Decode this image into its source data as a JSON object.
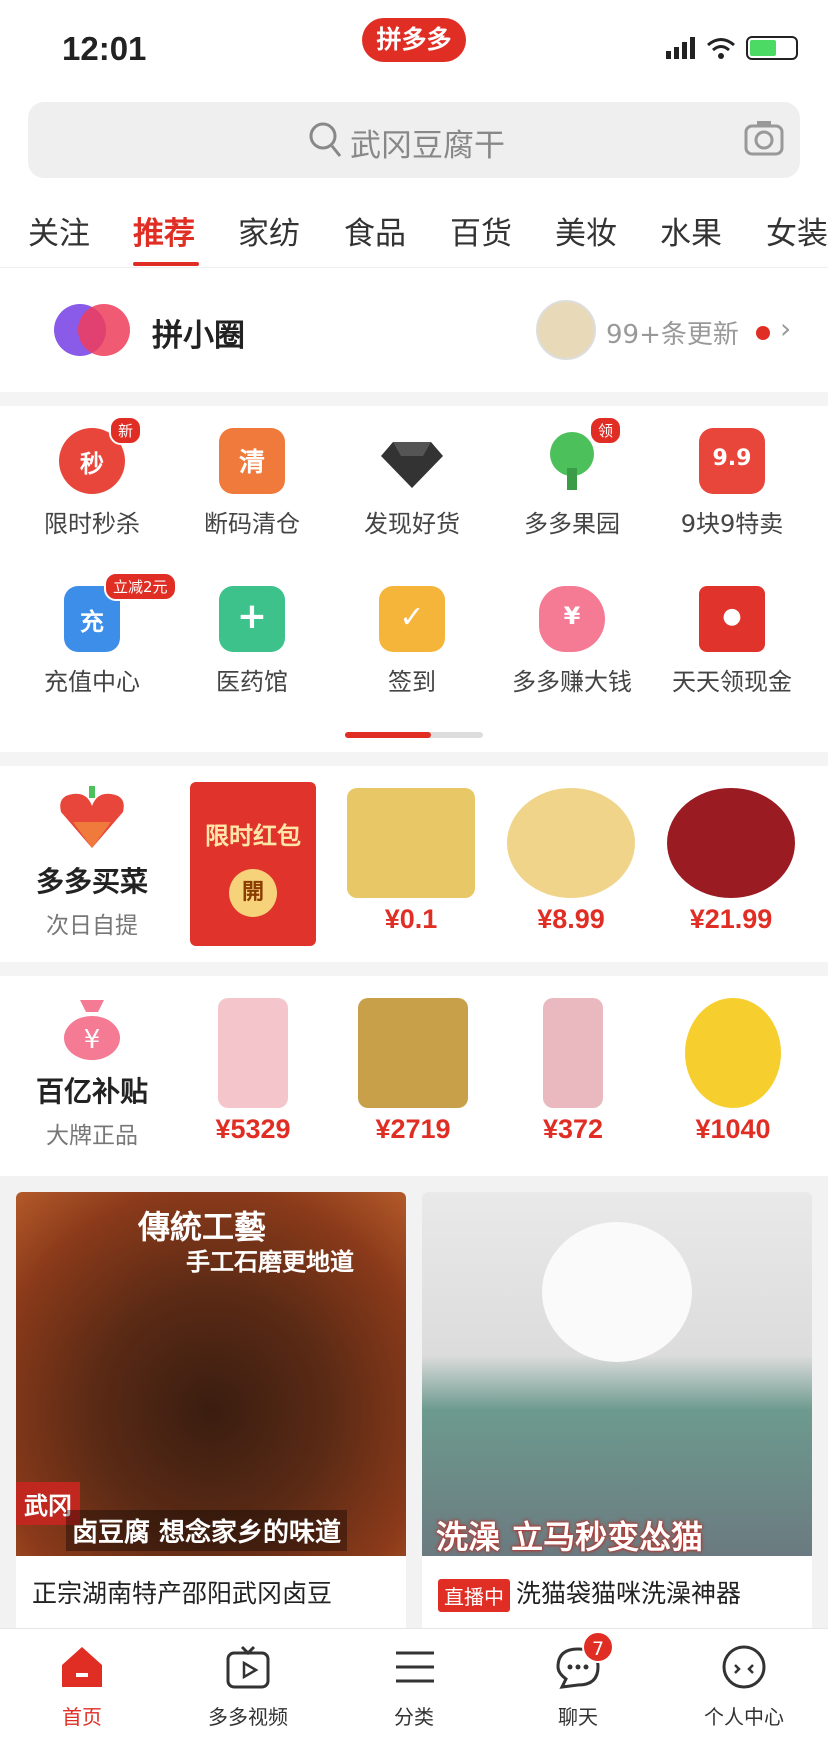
{
  "status_bar": {
    "time": "12:01",
    "app_logo": "拼多多"
  },
  "search": {
    "placeholder": "武冈豆腐干"
  },
  "tabs": [
    "关注",
    "推荐",
    "家纺",
    "食品",
    "百货",
    "美妆",
    "水果",
    "女装"
  ],
  "active_tab": "推荐",
  "circle": {
    "title": "拼小圈",
    "updates": "99+条更新"
  },
  "grid": [
    {
      "label": "限时秒杀",
      "icon": "alarm-clock-icon",
      "color": "#e8463a",
      "glyph": "秒",
      "badge": "新"
    },
    {
      "label": "断码清仓",
      "icon": "delivery-truck-icon",
      "color": "#f07a3c",
      "glyph": "清"
    },
    {
      "label": "发现好货",
      "icon": "diamond-icon",
      "color": "#333333"
    },
    {
      "label": "多多果园",
      "icon": "tree-icon",
      "color": "#4cc05a",
      "badge": "领"
    },
    {
      "label": "9块9特卖",
      "icon": "tag-icon",
      "color": "#e8463a",
      "glyph": "9.9"
    },
    {
      "label": "充值中心",
      "icon": "phone-topup-icon",
      "color": "#3d8ee8",
      "glyph": "充",
      "badge": "立减2元"
    },
    {
      "label": "医药馆",
      "icon": "medical-kit-icon",
      "color": "#3cc28a",
      "glyph": "+"
    },
    {
      "label": "签到",
      "icon": "calendar-check-icon",
      "color": "#f5b43a",
      "glyph": "✓"
    },
    {
      "label": "多多赚大钱",
      "icon": "piggy-bank-icon",
      "color": "#f57a94",
      "glyph": "¥"
    },
    {
      "label": "天天领现金",
      "icon": "red-envelope-icon",
      "color": "#e0332b",
      "glyph": "●"
    }
  ],
  "grocery": {
    "title": "多多买菜",
    "subtitle": "次日自提",
    "red_packet": {
      "title": "限时红包",
      "button": "開"
    },
    "products": [
      {
        "price": "¥0.1",
        "color": "#e8c766"
      },
      {
        "price": "¥8.99",
        "color": "#f0d48a"
      },
      {
        "price": "¥21.99",
        "color": "#9b1b23"
      }
    ]
  },
  "subsidy": {
    "title": "百亿补贴",
    "subtitle": "大牌正品",
    "products": [
      {
        "price": "¥5329",
        "color": "#f4c6cc"
      },
      {
        "price": "¥2719",
        "color": "#c9a04a"
      },
      {
        "price": "¥372",
        "color": "#eab9bf"
      },
      {
        "price": "¥1040",
        "color": "#f6cf2f"
      }
    ]
  },
  "feed": [
    {
      "title": "正宗湖南特产邵阳武冈卤豆",
      "overlay_top": "傳統工藝",
      "overlay_top2": "手工石磨更地道",
      "overlay_bottom_tag": "武冈",
      "overlay_bottom": "卤豆腐 想念家乡的味道"
    },
    {
      "title": "洗猫袋猫咪洗澡神器",
      "live_tag": "直播中",
      "overlay_bottom": "洗澡 立马秒变怂猫"
    }
  ],
  "bottom_nav": [
    {
      "label": "首页",
      "icon": "home-icon"
    },
    {
      "label": "多多视频",
      "icon": "tv-video-icon"
    },
    {
      "label": "分类",
      "icon": "list-icon"
    },
    {
      "label": "聊天",
      "icon": "chat-bubble-icon",
      "badge": "7"
    },
    {
      "label": "个人中心",
      "icon": "profile-icon"
    }
  ]
}
